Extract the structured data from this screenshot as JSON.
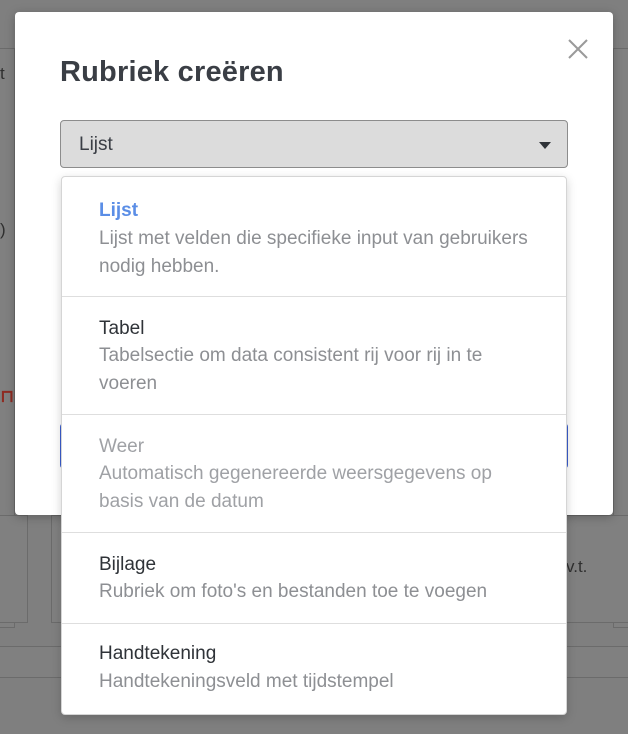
{
  "modal": {
    "title": "Rubriek creëren",
    "close_icon": "close-icon"
  },
  "select": {
    "value": "Lijst",
    "icon": "chevron-down-icon"
  },
  "options": [
    {
      "title": "Lijst",
      "description": "Lijst met velden die specifieke input van gebruikers nodig hebben.",
      "state": "selected"
    },
    {
      "title": "Tabel",
      "description": "Tabelsectie om data consistent rij voor rij in te voeren",
      "state": "normal"
    },
    {
      "title": "Weer",
      "description": "Automatisch gegenereerde weersgegevens op basis van de datum",
      "state": "disabled"
    },
    {
      "title": "Bijlage",
      "description": "Rubriek om foto's en bestanden toe te voegen",
      "state": "normal"
    },
    {
      "title": "Handtekening",
      "description": "Handtekeningsveld met tijdstempel",
      "state": "normal"
    }
  ],
  "background": {
    "fragment_left_top": "t",
    "fragment_left_mid": ")",
    "fragment_right": "v.t."
  },
  "colors": {
    "accent": "#5b8ee6",
    "overlay": "#7f7f7f",
    "button": "#3b5fd0"
  }
}
